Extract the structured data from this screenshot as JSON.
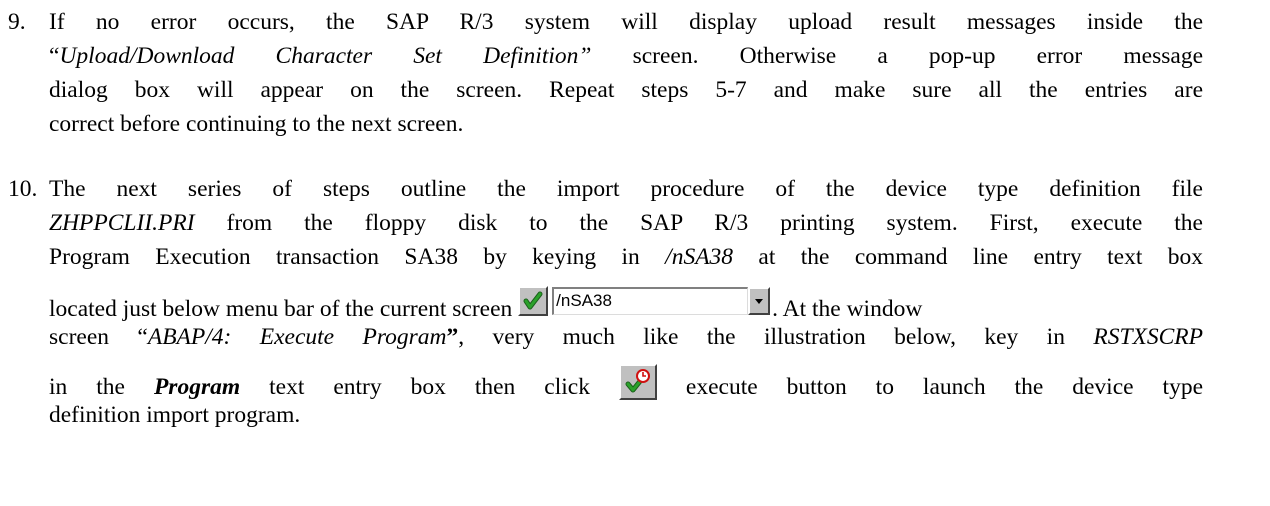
{
  "item9": {
    "number": "9.",
    "lines": [
      {
        "a": "If no error occurs, the SAP R/3 system will display upload result messages inside the"
      },
      {
        "q1": "“",
        "i": "Upload/Download Character Set Definition”",
        "rest": " screen.  Otherwise a pop-up error message"
      },
      {
        "a": "dialog box will appear on the screen.  Repeat steps 5-7 and make sure all the entries are"
      },
      {
        "a": "correct before continuing to the next screen."
      }
    ]
  },
  "item10": {
    "number": "10.",
    "line1": "The next series of steps outline the import procedure of the device type definition file",
    "line2_file": "ZHPPCLII.PRI",
    "line2_rest": " from the floppy disk to the SAP R/3 printing system.  First, execute the",
    "line3_pre": "Program Execution transaction SA38 by keying in ",
    "line3_cmd": "/nSA38",
    "line3_post": " at the command line entry text box",
    "line4_pre": "located just below menu bar of the current screen ",
    "line4_post": ".  At the window",
    "line5_pre": "screen “",
    "line5_screen": "ABAP/4: Execute Program",
    "line5_quote": "”",
    "line5_mid": ", very much like the illustration below, key in ",
    "line5_prog": "RSTXSCRP",
    "line6_pre": "in the ",
    "line6_field": "Program",
    "line6_mid": " text entry box then click ",
    "line6_post": " execute button to launch the device type",
    "line7": "definition import program."
  },
  "command_field": {
    "value": "/nSA38",
    "icons": [
      "green-checkmark-icon",
      "dropdown-arrow-icon"
    ]
  },
  "execute_button": {
    "icon": "execute-clock-check-icon"
  },
  "colors": {
    "check_green": "#2aa12a",
    "check_dark": "#1b5e1b",
    "button_face": "#c0c0c0",
    "clock_red": "#d01010"
  }
}
